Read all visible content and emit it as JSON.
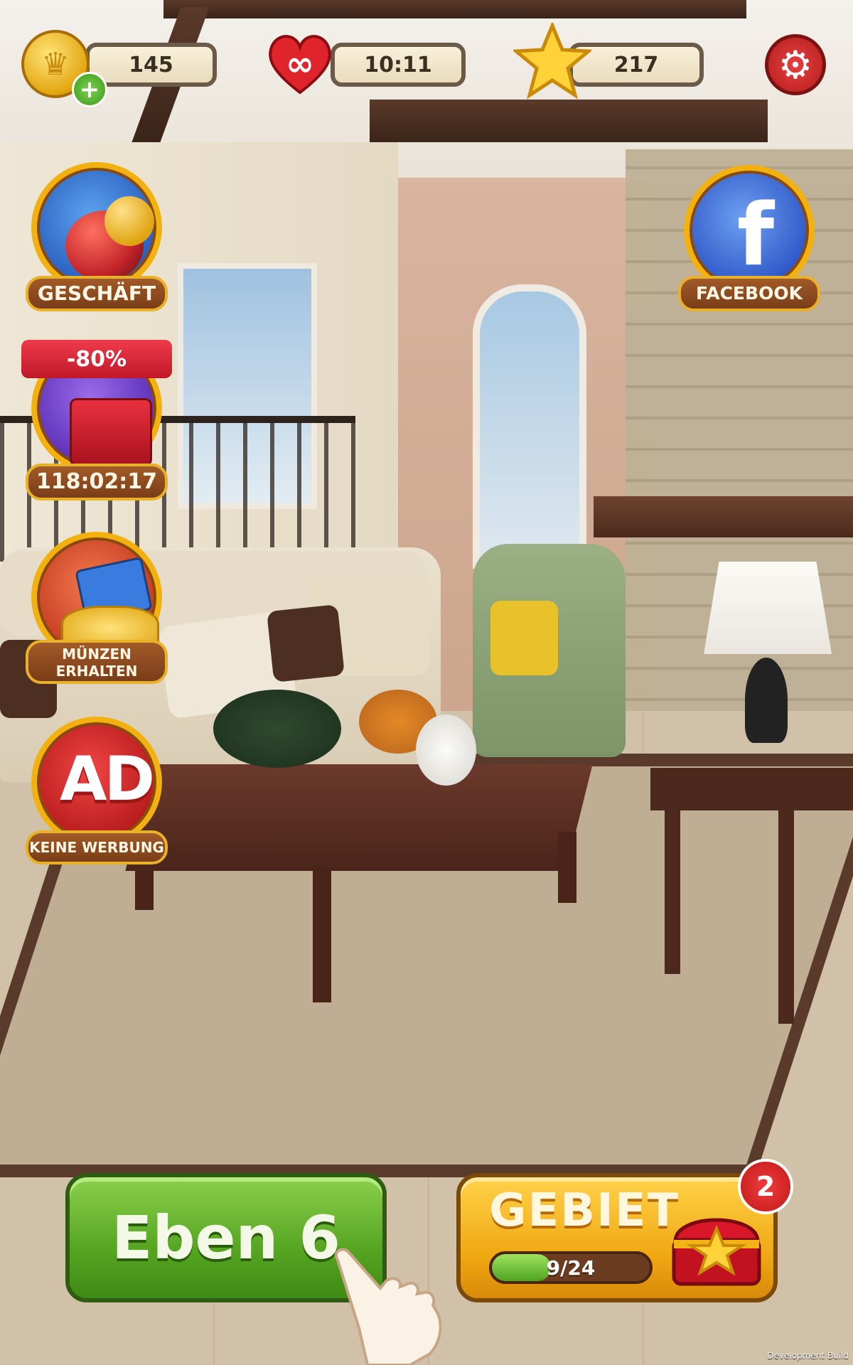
{
  "hud": {
    "coins": {
      "value": "145",
      "icon": "crown-coin-icon",
      "add_icon": "plus-icon"
    },
    "lives": {
      "value": "10:11",
      "icon": "infinity-heart-icon"
    },
    "stars": {
      "value": "217",
      "icon": "star-icon"
    },
    "settings": {
      "icon": "gear-icon"
    }
  },
  "side_buttons": {
    "shop": {
      "label": "GESCHÄFT"
    },
    "offer": {
      "discount": "-80%",
      "timer": "118:02:17"
    },
    "free_coins": {
      "label_line1": "MÜNZEN",
      "label_line2": "ERHALTEN"
    },
    "no_ads": {
      "icon_text": "AD",
      "label": "KEINE WERBUNG"
    },
    "facebook": {
      "label": "FACEBOOK",
      "icon_text": "f"
    }
  },
  "bottom": {
    "level_button": {
      "label": "Eben 6"
    },
    "area_button": {
      "title": "GEBIET",
      "progress_text": "9/24",
      "progress_fraction": 0.375,
      "badge_count": "2"
    }
  },
  "footer": {
    "build_label": "Development Build"
  },
  "colors": {
    "coin_gold": "#e3a711",
    "heart_red": "#e0242c",
    "level_green": "#55a521",
    "area_orange": "#f0a812",
    "badge_red": "#c21818"
  }
}
